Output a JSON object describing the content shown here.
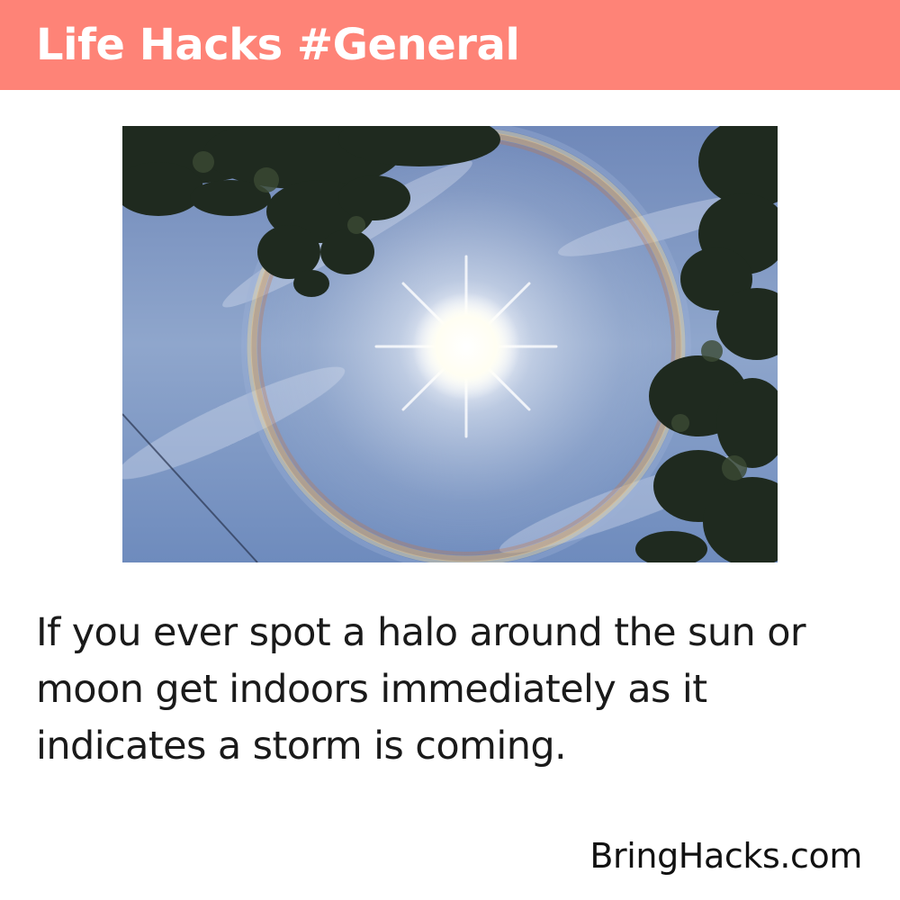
{
  "header": {
    "title": "Life Hacks #General",
    "background_color": "#fe8377"
  },
  "photo": {
    "subject": "sun-halo-photo"
  },
  "hack": {
    "text": "If you ever spot a halo around the sun or moon get indoors immediately as it indicates a storm is coming."
  },
  "footer": {
    "brand": "BringHacks.com"
  }
}
